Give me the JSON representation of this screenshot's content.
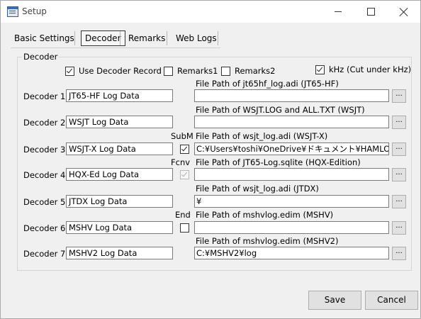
{
  "window": {
    "title": "Setup",
    "buttons": {
      "minimize": "minimize",
      "maximize": "maximize",
      "close": "close"
    }
  },
  "tabs": [
    {
      "label": "Basic Settings",
      "active": false
    },
    {
      "label": "Decoder",
      "active": true
    },
    {
      "label": "Remarks",
      "active": false
    },
    {
      "label": "Web Logs",
      "active": false
    }
  ],
  "group": {
    "title": "Decoder",
    "options": {
      "use_decoder_record": {
        "label": "Use Decoder Record",
        "checked": true
      },
      "remarks1": {
        "label": "Remarks1",
        "checked": false
      },
      "remarks2": {
        "label": "Remarks2",
        "checked": false
      },
      "khz": {
        "label": "kHz (Cut under kHz)",
        "checked": true
      }
    },
    "decoders": [
      {
        "label": "Decoder 1",
        "name": "JT65-HF Log Data",
        "path_caption": "File Path of jt65hf_log.adi (JT65-HF)",
        "path": ""
      },
      {
        "label": "Decoder 2",
        "name": "WSJT Log Data",
        "path_caption": "File Path of WSJT.LOG and ALL.TXT (WSJT)",
        "path": ""
      },
      {
        "label": "Decoder 3",
        "name": "WSJT-X Log Data",
        "path_caption": "File Path of wsjt_log.adi (WSJT-X)",
        "path": "C:¥Users¥toshi¥OneDrive¥ドキュメント¥HAMLOG",
        "side_label": "SubM",
        "side_checked": true
      },
      {
        "label": "Decoder 4",
        "name": "HQX-Ed Log Data",
        "path_caption": "File Path of JT65-Log.sqlite (HQX-Edition)",
        "path": "",
        "side_label": "Fcnv",
        "side_checked": true
      },
      {
        "label": "Decoder 5",
        "name": "JTDX Log Data",
        "path_caption": "File Path of wsjt_log.adi (JTDX)",
        "path": "¥"
      },
      {
        "label": "Decoder 6",
        "name": "MSHV Log Data",
        "path_caption": "File Path of mshvlog.edim (MSHV)",
        "path": "",
        "side_label": "End",
        "side_checked": false
      },
      {
        "label": "Decoder 7",
        "name": "MSHV2 Log Data",
        "path_caption": "File Path of mshvlog.edim (MSHV2)",
        "path": "C:¥MSHV2¥log"
      }
    ],
    "browse_label": "..."
  },
  "footer": {
    "save_label": "Save",
    "cancel_label": "Cancel"
  }
}
